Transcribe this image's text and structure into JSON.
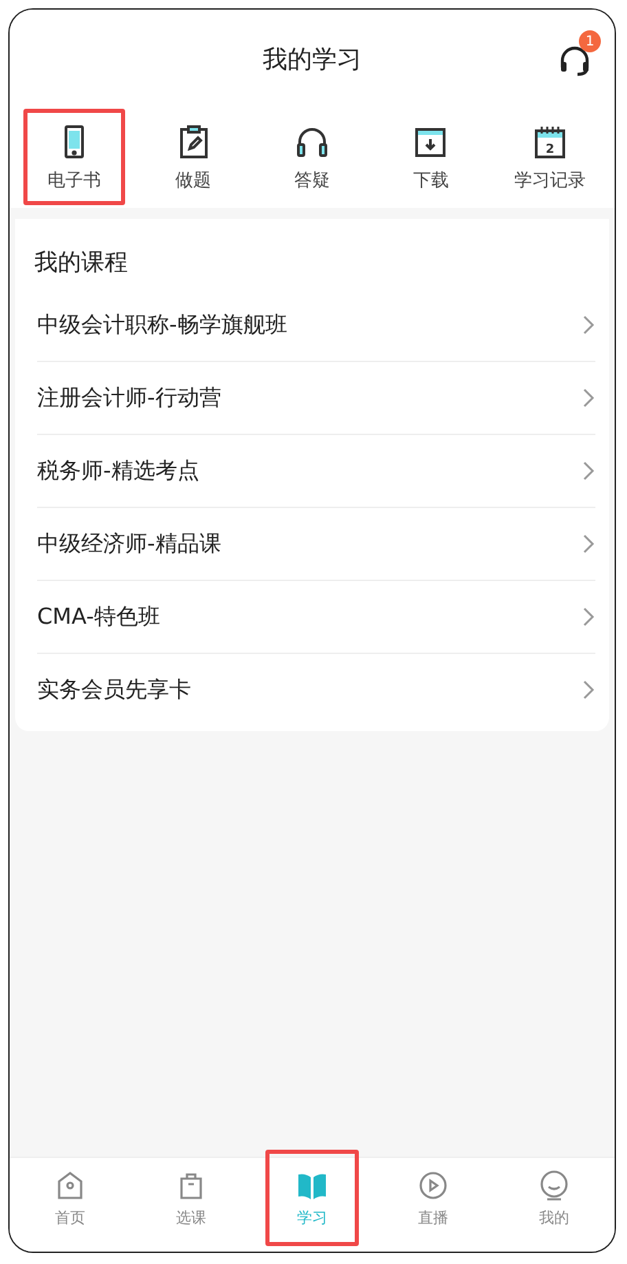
{
  "header": {
    "title": "我的学习",
    "badge": "1"
  },
  "shortcuts": [
    {
      "kind": "phone",
      "label": "电子书",
      "highlighted": true
    },
    {
      "kind": "clipboard",
      "label": "做题",
      "highlighted": false
    },
    {
      "kind": "headphones",
      "label": "答疑",
      "highlighted": false
    },
    {
      "kind": "folder",
      "label": "下载",
      "highlighted": false
    },
    {
      "kind": "calendar",
      "label": "学习记录",
      "highlighted": false,
      "icon_text": "2"
    }
  ],
  "courses": {
    "title": "我的课程",
    "items": [
      {
        "name": "中级会计职称-畅学旗舰班"
      },
      {
        "name": "注册会计师-行动营"
      },
      {
        "name": "税务师-精选考点"
      },
      {
        "name": "中级经济师-精品课"
      },
      {
        "name": "CMA-特色班"
      },
      {
        "name": "实务会员先享卡"
      }
    ]
  },
  "tabbar": [
    {
      "kind": "home",
      "label": "首页",
      "selected": false,
      "highlighted": false
    },
    {
      "kind": "bag",
      "label": "选课",
      "selected": false,
      "highlighted": false
    },
    {
      "kind": "book",
      "label": "学习",
      "selected": true,
      "highlighted": true
    },
    {
      "kind": "play",
      "label": "直播",
      "selected": false,
      "highlighted": false
    },
    {
      "kind": "face",
      "label": "我的",
      "selected": false,
      "highlighted": false
    }
  ]
}
